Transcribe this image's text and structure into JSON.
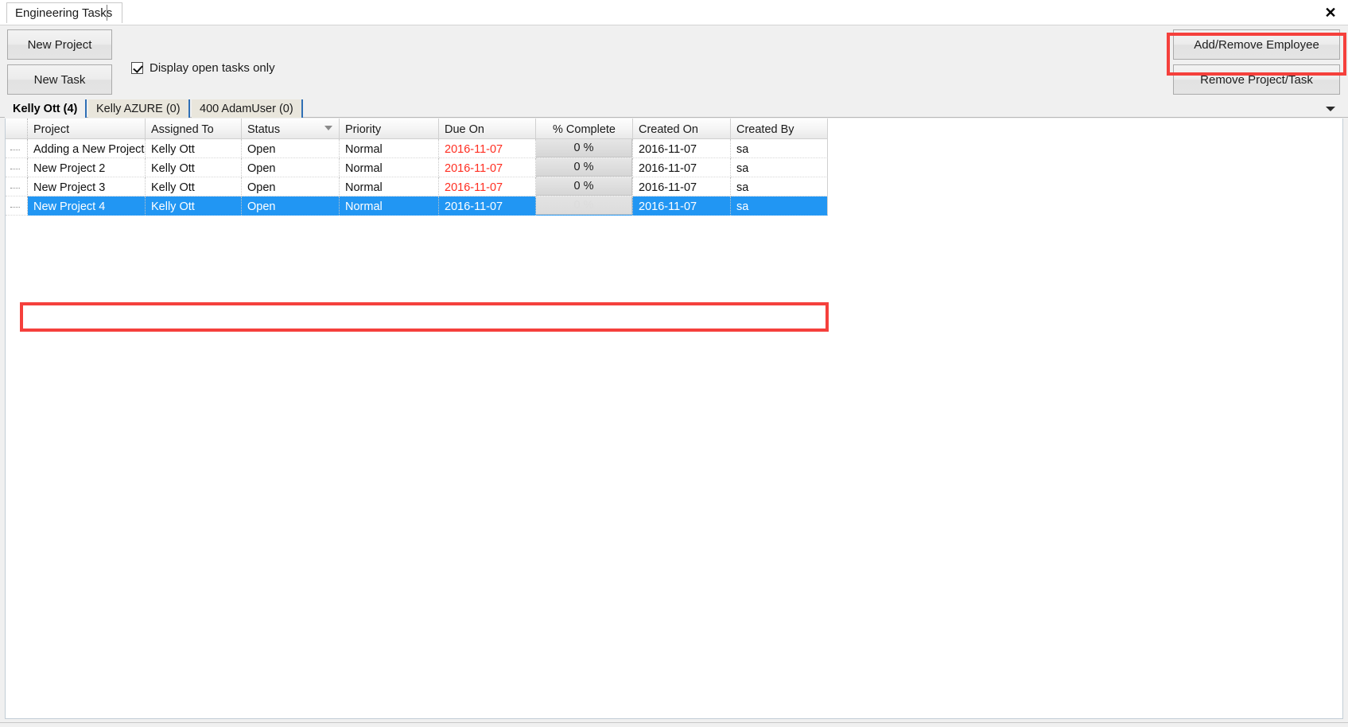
{
  "window": {
    "document_tab": "Engineering Tasks",
    "close_icon": "close-icon",
    "close_glyph": "✕"
  },
  "toolbar": {
    "new_project_label": "New Project",
    "new_task_label": "New Task",
    "add_remove_employee_label": "Add/Remove Employee",
    "remove_project_task_label": "Remove Project/Task",
    "checkbox": {
      "label": "Display open tasks only",
      "checked": true
    }
  },
  "employee_tabs": {
    "items": [
      {
        "label": "Kelly Ott (4)",
        "active": true
      },
      {
        "label": "Kelly AZURE (0)",
        "active": false
      },
      {
        "label": "400 AdamUser (0)",
        "active": false
      }
    ],
    "overflow_icon": "chevron-down-icon"
  },
  "grid": {
    "columns": [
      {
        "key": "project",
        "label": "Project",
        "sorted": false
      },
      {
        "key": "assigned_to",
        "label": "Assigned To",
        "sorted": false
      },
      {
        "key": "status",
        "label": "Status",
        "sorted": true
      },
      {
        "key": "priority",
        "label": "Priority",
        "sorted": false
      },
      {
        "key": "due_on",
        "label": "Due On",
        "sorted": false
      },
      {
        "key": "pct_complete",
        "label": "% Complete",
        "sorted": false
      },
      {
        "key": "created_on",
        "label": "Created On",
        "sorted": false
      },
      {
        "key": "created_by",
        "label": "Created By",
        "sorted": false
      }
    ],
    "rows": [
      {
        "project": "Adding a New Project",
        "assigned_to": "Kelly Ott",
        "status": "Open",
        "priority": "Normal",
        "due_on": "2016-11-07",
        "due_overdue": true,
        "pct_complete": "0 %",
        "created_on": "2016-11-07",
        "created_by": "sa",
        "selected": false
      },
      {
        "project": "New Project 2",
        "assigned_to": "Kelly Ott",
        "status": "Open",
        "priority": "Normal",
        "due_on": "2016-11-07",
        "due_overdue": true,
        "pct_complete": "0 %",
        "created_on": "2016-11-07",
        "created_by": "sa",
        "selected": false
      },
      {
        "project": "New Project 3",
        "assigned_to": "Kelly Ott",
        "status": "Open",
        "priority": "Normal",
        "due_on": "2016-11-07",
        "due_overdue": true,
        "pct_complete": "0 %",
        "created_on": "2016-11-07",
        "created_by": "sa",
        "selected": false
      },
      {
        "project": "New Project 4",
        "assigned_to": "Kelly Ott",
        "status": "Open",
        "priority": "Normal",
        "due_on": "2016-11-07",
        "due_overdue": false,
        "pct_complete": "0 %",
        "created_on": "2016-11-07",
        "created_by": "sa",
        "selected": true
      }
    ]
  },
  "colors": {
    "selection_blue": "#2196f3",
    "annotation_red": "#f5403c",
    "overdue_red": "#ff2d20",
    "tab_active_underline": "#2f6fb5"
  }
}
